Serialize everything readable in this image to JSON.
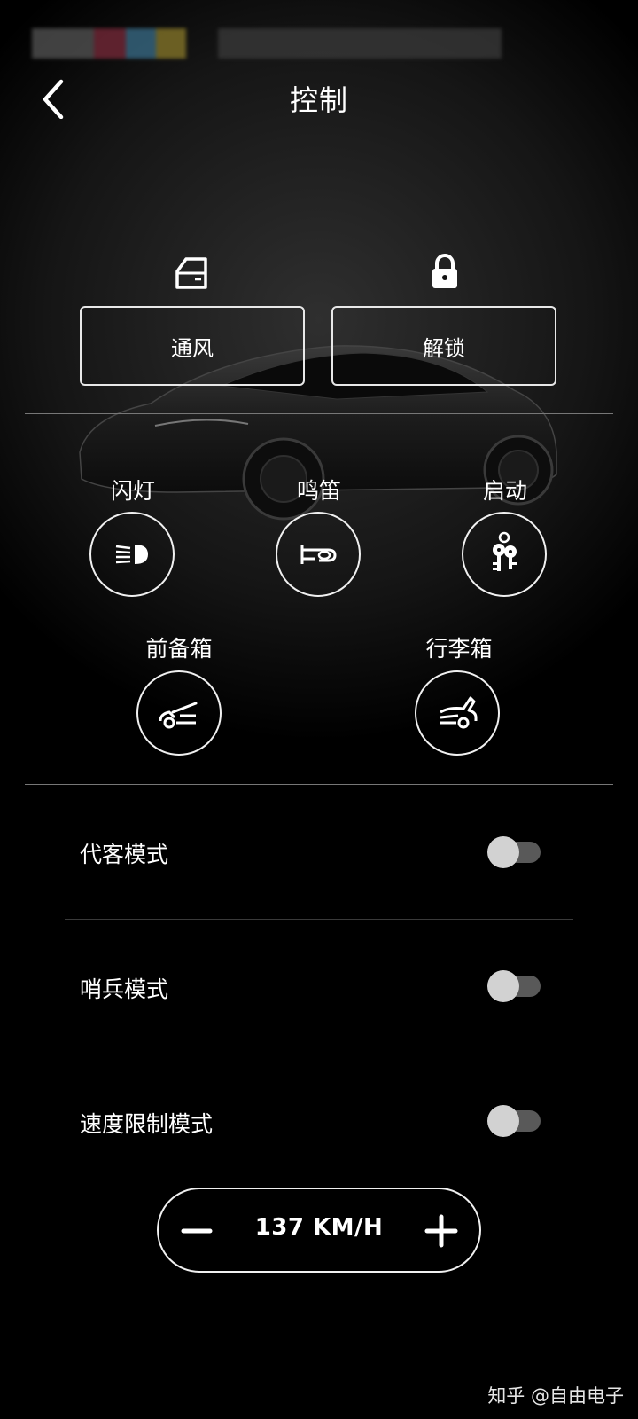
{
  "header": {
    "title": "控制"
  },
  "top_actions": [
    {
      "label": "通风",
      "icon": "window-icon"
    },
    {
      "label": "解锁",
      "icon": "lock-icon"
    }
  ],
  "controls": [
    {
      "label": "闪灯",
      "icon": "headlight-icon"
    },
    {
      "label": "鸣笛",
      "icon": "horn-icon"
    },
    {
      "label": "启动",
      "icon": "keys-icon"
    },
    {
      "label": "前备箱",
      "icon": "frunk-icon"
    },
    {
      "label": "行李箱",
      "icon": "trunk-icon"
    }
  ],
  "modes": [
    {
      "label": "代客模式",
      "on": false
    },
    {
      "label": "哨兵模式",
      "on": false
    },
    {
      "label": "速度限制模式",
      "on": false
    }
  ],
  "speed_limit": {
    "value": "137 KM/H"
  },
  "watermark": "知乎 @自由电子",
  "colors": {
    "background": "#000000",
    "toggle_track": "#595959",
    "toggle_knob": "#d2d2d2",
    "outline": "#f0f0f0"
  }
}
